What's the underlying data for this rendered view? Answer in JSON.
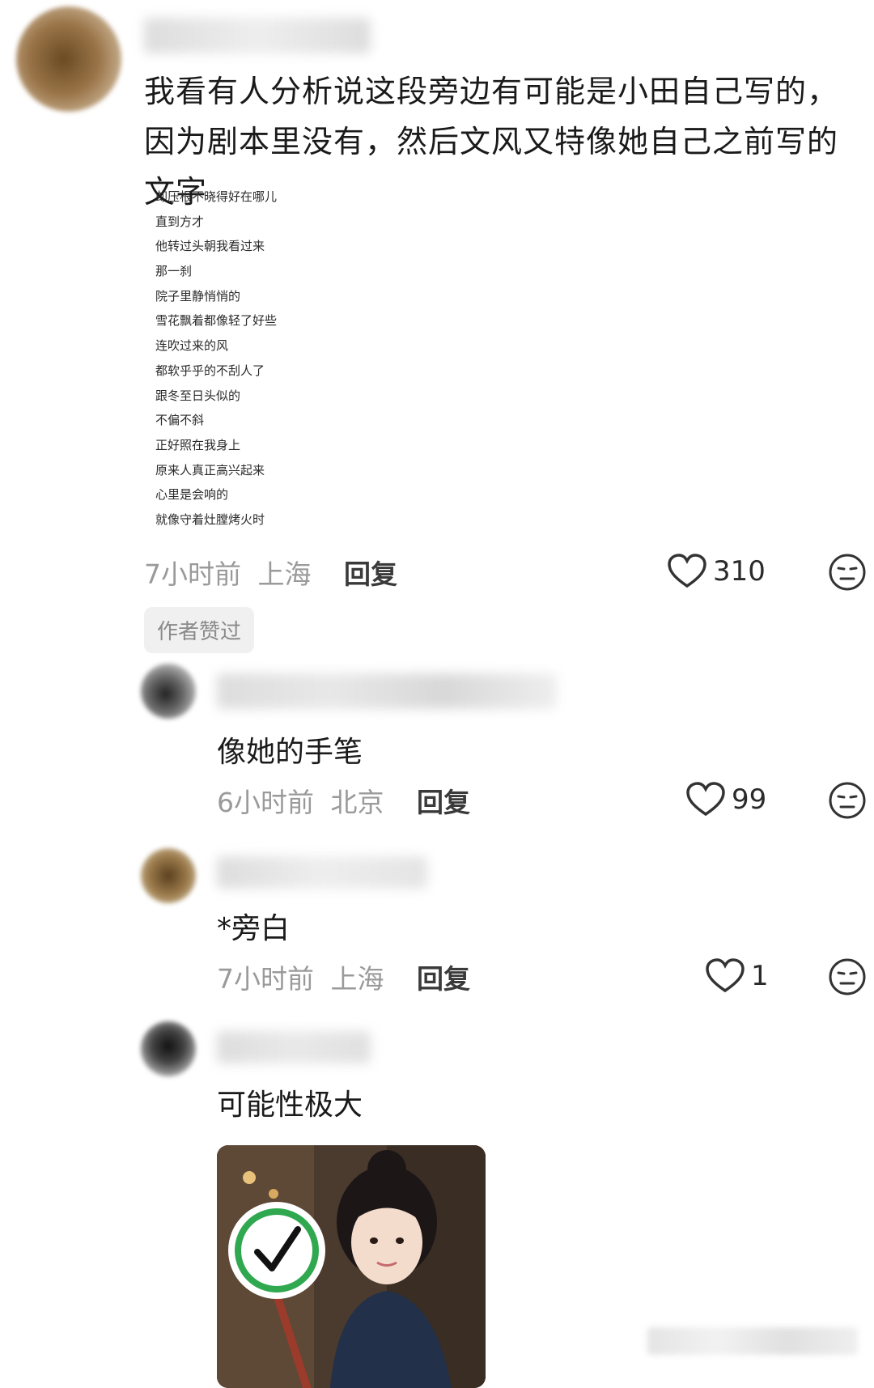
{
  "main_comment": {
    "text": "我看有人分析说这段旁边有可能是小田自己写的，因为剧本里没有，然后文风又特像她自己之前写的文字",
    "poem_lines": [
      "却压根不晓得好在哪儿",
      "直到方才",
      "他转过头朝我看过来",
      "那一刹",
      "院子里静悄悄的",
      "雪花飘着都像轻了好些",
      "连吹过来的风",
      "都软乎乎的不刮人了",
      "跟冬至日头似的",
      "不偏不斜",
      "正好照在我身上",
      "原来人真正高兴起来",
      "心里是会响的",
      "就像守着灶膛烤火时"
    ],
    "time": "7小时前",
    "location": "上海",
    "reply_label": "回复",
    "likes": "310",
    "badge": "作者赞过"
  },
  "replies": [
    {
      "text": "像她的手笔",
      "time": "6小时前",
      "location": "北京",
      "reply_label": "回复",
      "likes": "99"
    },
    {
      "text": "*旁白",
      "time": "7小时前",
      "location": "上海",
      "reply_label": "回复",
      "likes": "1"
    },
    {
      "text": "可能性极大"
    }
  ],
  "colors": {
    "meta_gray": "#9a9a9a",
    "badge_bg": "#f0f0f0",
    "check_green": "#2fa84f"
  }
}
